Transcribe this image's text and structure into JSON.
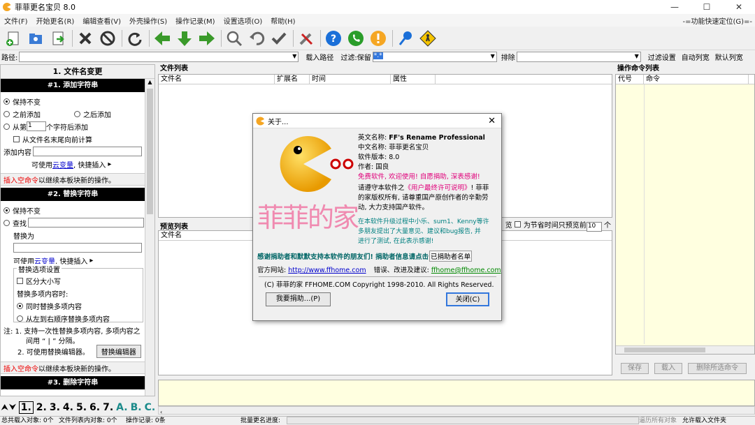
{
  "window": {
    "title": "菲菲更名宝贝  8.0",
    "min": "—",
    "max": "☐",
    "close": "✕"
  },
  "menu": [
    "文件(F)",
    "开始更名(R)",
    "编辑查看(V)",
    "外壳操作(S)",
    "操作记录(M)",
    "设置选项(O)",
    "帮助(H)"
  ],
  "quick_locate": "-=功能快速定位(G)=-",
  "toolbar_icons": [
    "add-file-icon",
    "add-folder-icon",
    "import-icon",
    "delete-icon",
    "stop-icon",
    "refresh-icon",
    "arrow-left-icon",
    "arrow-down-icon",
    "arrow-right-icon",
    "search-icon",
    "undo-icon",
    "check-icon",
    "tools-icon",
    "help-icon",
    "phone-icon",
    "info-icon",
    "pin-icon",
    "sign-icon"
  ],
  "pathbar": {
    "path_label": "路径:",
    "import_path": "载入路径",
    "filter_label": "过滤:保留",
    "filter_value": "*.*",
    "exclude_label": "排除",
    "filter_settings": "过滤设置",
    "auto_width": "自动列宽",
    "default_width": "默认列宽"
  },
  "left": {
    "section_title": "1. 文件名变更",
    "h1": "#1. 添加字符串",
    "keep": "保持不变",
    "before": "之前添加",
    "after": "之后添加",
    "from_n": "从第",
    "from_n_value": "1",
    "from_n_suffix": "个字符后添加",
    "from_end": "从文件名末尾向前计算",
    "add_content": "添加内容",
    "can_use": "可使用",
    "cloud_var": "云变量",
    "quick_insert": ", 快捷插入",
    "insert_empty": "插入空命令",
    "insert_empty_suffix": " 以继续本板块新的操作。",
    "h2": "#2. 替换字符串",
    "keep2": "保持不变",
    "find": "查找",
    "replace_as": "替换为",
    "replace_options": "替换选项设置",
    "case": "区分大小写",
    "multi_replace": "替换多项内容时:",
    "simul": "同时替换多项内容",
    "seq": "从左到右顺序替换多项内容",
    "note1": "注: 1. 支持一次性替换多项内容, 多项内容之",
    "note1b": "间用 “ | ” 分隔。",
    "note2": "2. 可使用替换编辑器。",
    "replace_editor": "替换编辑器",
    "h3": "#3. 删除字符串"
  },
  "tabs": [
    "1.",
    "2.",
    "3.",
    "4.",
    "5.",
    "6.",
    "7.",
    "A.",
    "B.",
    "C."
  ],
  "filelist": {
    "title": "文件列表",
    "cols": [
      "文件名",
      "扩展名",
      "时间",
      "属性"
    ]
  },
  "preview": {
    "title": "预览列表",
    "col": "文件名",
    "right_text": "为节省时间只预览前",
    "count": "10",
    "unit": "个",
    "cut_prefix": "览"
  },
  "ops": {
    "title": "操作命令列表",
    "cols": [
      "代号",
      "命令"
    ],
    "save": "保存",
    "load": "载入",
    "delete_selected": "删除所选命令"
  },
  "dialog": {
    "title": "关于...",
    "en_name_l": "英文名称:",
    "en_name": "FF's Rename Professional",
    "cn_name_l": "中文名称:",
    "cn_name": "菲菲更名宝贝",
    "ver_l": "软件版本:",
    "ver": "8.0",
    "author_l": "作者:",
    "author": "国良",
    "free": "免费软件, 欢迎使用! 自愿捐助, 深表感谢!",
    "lic1": "请遵守本软件之",
    "lic_link": "《用户最终许可说明》",
    "lic1b": "! 菲菲",
    "lic2": "的家版权所有, 请尊重国产原创作者的辛勤劳",
    "lic3": "动, 大力支持国产软件。",
    "thx1": "在本软件升级过程中小乐、sum1、Kenny等许",
    "thx2": "多朋友提出了大量意见、建议和bug报告, 并",
    "thx3": "进行了测试, 在此表示感谢!",
    "logo_text": "菲菲的家",
    "donor_thanks": "感谢捐助者和默默支持本软件的朋友们! 捐助者信息请点击",
    "donor_btn": "已捐助者名单",
    "site_l": "官方网站:",
    "site": "http://www.ffhome.com",
    "report_l": "错误、改进及建议:",
    "email": "ffhome@ffhome.com",
    "copyright": "(C) 菲菲的家 FFHOME.COM  Copyright 1998-2010.  All Rights Reserved.",
    "donate_btn": "我要捐助...(P)",
    "close_btn": "关闭(C)"
  },
  "status": {
    "total": "总共载入对象: 0个",
    "filelist": "文件列表内对象: 0个",
    "oplog": "操作记录: 0条",
    "batch": "批量更名进度:",
    "all": "逼历所有对象",
    "allow": "允许载入文件夹"
  },
  "colors": {
    "accent": "#0055cc",
    "dialog_magenta": "#e0007a",
    "teal": "#008080"
  }
}
